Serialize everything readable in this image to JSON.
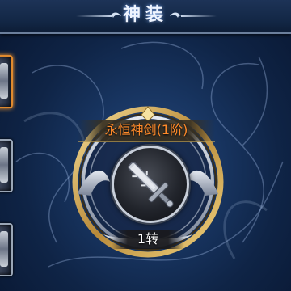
{
  "header": {
    "title": "神装"
  },
  "side_slots": [
    {
      "state": "selected"
    },
    {
      "state": "normal"
    },
    {
      "state": "normal"
    }
  ],
  "item": {
    "name": "永恒神剑(1阶)",
    "level": "1转",
    "icon": "sword-icon"
  },
  "colors": {
    "background": "#183561",
    "name_text": "#ff8a2a",
    "ring_gold": "#d8b25a",
    "selected_slot": "#e08a2e"
  }
}
